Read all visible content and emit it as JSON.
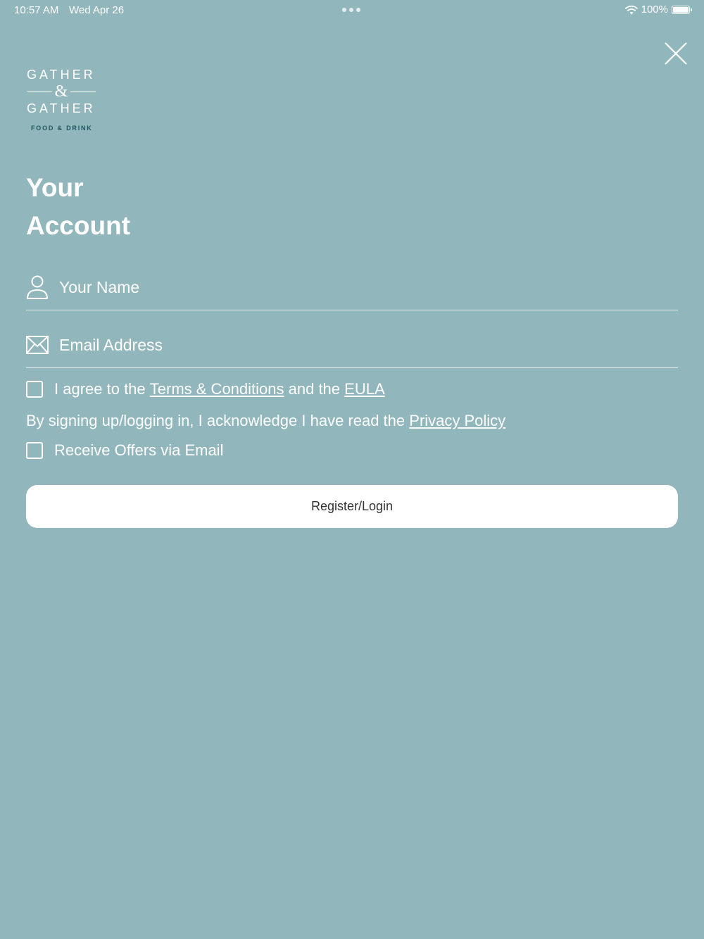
{
  "status_bar": {
    "time": "10:57 AM",
    "date": "Wed Apr 26",
    "battery": "100%"
  },
  "logo": {
    "line1": "GATHER",
    "amp": "&",
    "line2": "GATHER",
    "tagline": "FOOD & DRINK"
  },
  "title": {
    "line1": "Your",
    "line2": "Account"
  },
  "form": {
    "name_placeholder": "Your Name",
    "email_placeholder": "Email Address",
    "terms": {
      "prefix": "I agree to the ",
      "terms_link": "Terms & Conditions",
      "middle": " and the ",
      "eula_link": "EULA"
    },
    "privacy": {
      "prefix": "By signing up/logging in, I acknowledge I have read the ",
      "link": "Privacy Policy"
    },
    "offers_label": "Receive Offers via Email",
    "submit_label": "Register/Login"
  },
  "icons": {
    "close": "close-icon",
    "name": "person-icon",
    "email": "envelope-icon",
    "wifi": "wifi-icon",
    "battery": "battery-icon"
  },
  "colors": {
    "background": "#91b6bb",
    "tagline": "#1f5661",
    "button": "#ffffff",
    "button_text": "#333333"
  }
}
